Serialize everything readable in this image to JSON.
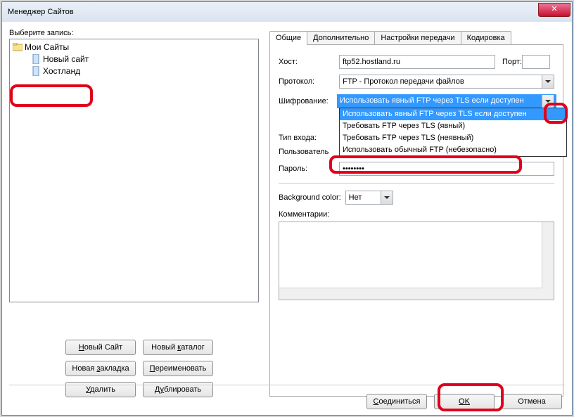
{
  "window": {
    "title": "Менеджер Сайтов"
  },
  "left": {
    "select_label": "Выберите запись:",
    "tree": {
      "root": "Мои Сайты",
      "items": [
        "Новый сайт",
        "Хостланд"
      ]
    },
    "buttons": {
      "new_site": "Новый Сайт",
      "new_folder": "Новый каталог",
      "new_bookmark": "Новая закладка",
      "rename": "Переименовать",
      "delete": "Удалить",
      "duplicate": "Дублировать"
    }
  },
  "tabs": {
    "general": "Общие",
    "advanced": "Дополнительно",
    "transfer": "Настройки передачи",
    "charset": "Кодировка"
  },
  "form": {
    "host_label": "Хост:",
    "host_value": "ftp52.hostland.ru",
    "port_label": "Порт:",
    "port_value": "",
    "protocol_label": "Протокол:",
    "protocol_value": "FTP - Протокол передачи файлов",
    "encryption_label": "Шифрование:",
    "encryption_value": "Использовать явный FTP через TLS если доступен",
    "encryption_options": [
      "Использовать явный FTP через TLS если доступен",
      "Требовать FTP через TLS (явный)",
      "Требовать FTP через TLS (неявный)",
      "Использовать обычный FTP (небезопасно)"
    ],
    "logon_label": "Тип входа:",
    "user_label": "Пользователь",
    "password_label": "Пароль:",
    "password_value": "••••••••",
    "bgcolor_label": "Background color:",
    "bgcolor_value": "Нет",
    "comments_label": "Комментарии:"
  },
  "footer": {
    "connect": "Соединиться",
    "ok": "OK",
    "cancel": "Отмена"
  }
}
